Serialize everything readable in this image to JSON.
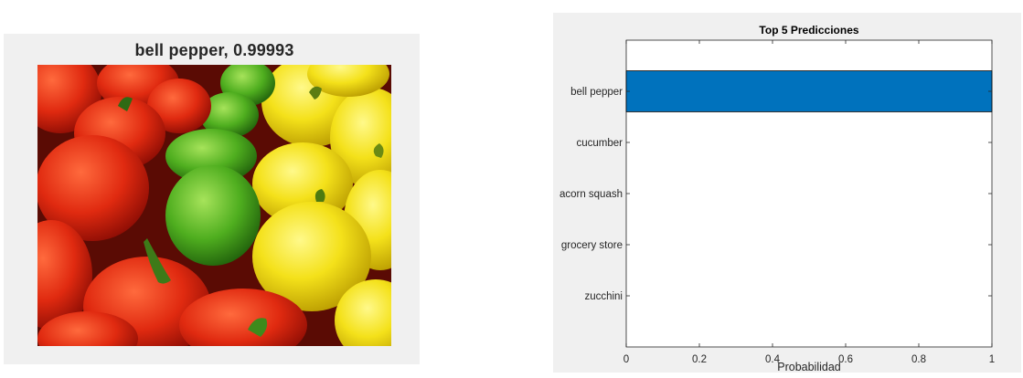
{
  "left_figure": {
    "title": "bell pepper, 0.99993",
    "image_subject": "bell-peppers-photo"
  },
  "chart_data": {
    "type": "bar",
    "orientation": "horizontal",
    "title": "Top 5 Predicciones",
    "xlabel": "Probabilidad",
    "ylabel": "",
    "categories": [
      "bell pepper",
      "cucumber",
      "acorn squash",
      "grocery store",
      "zucchini"
    ],
    "values": [
      0.99993,
      3e-05,
      2e-05,
      1e-05,
      1e-05
    ],
    "xlim": [
      0,
      1
    ],
    "xticks": [
      0,
      0.2,
      0.4,
      0.6,
      0.8,
      1
    ],
    "xtick_labels": [
      "0",
      "0.2",
      "0.4",
      "0.6",
      "0.8",
      "1"
    ],
    "grid": false,
    "bar_color": "#0072bd"
  }
}
